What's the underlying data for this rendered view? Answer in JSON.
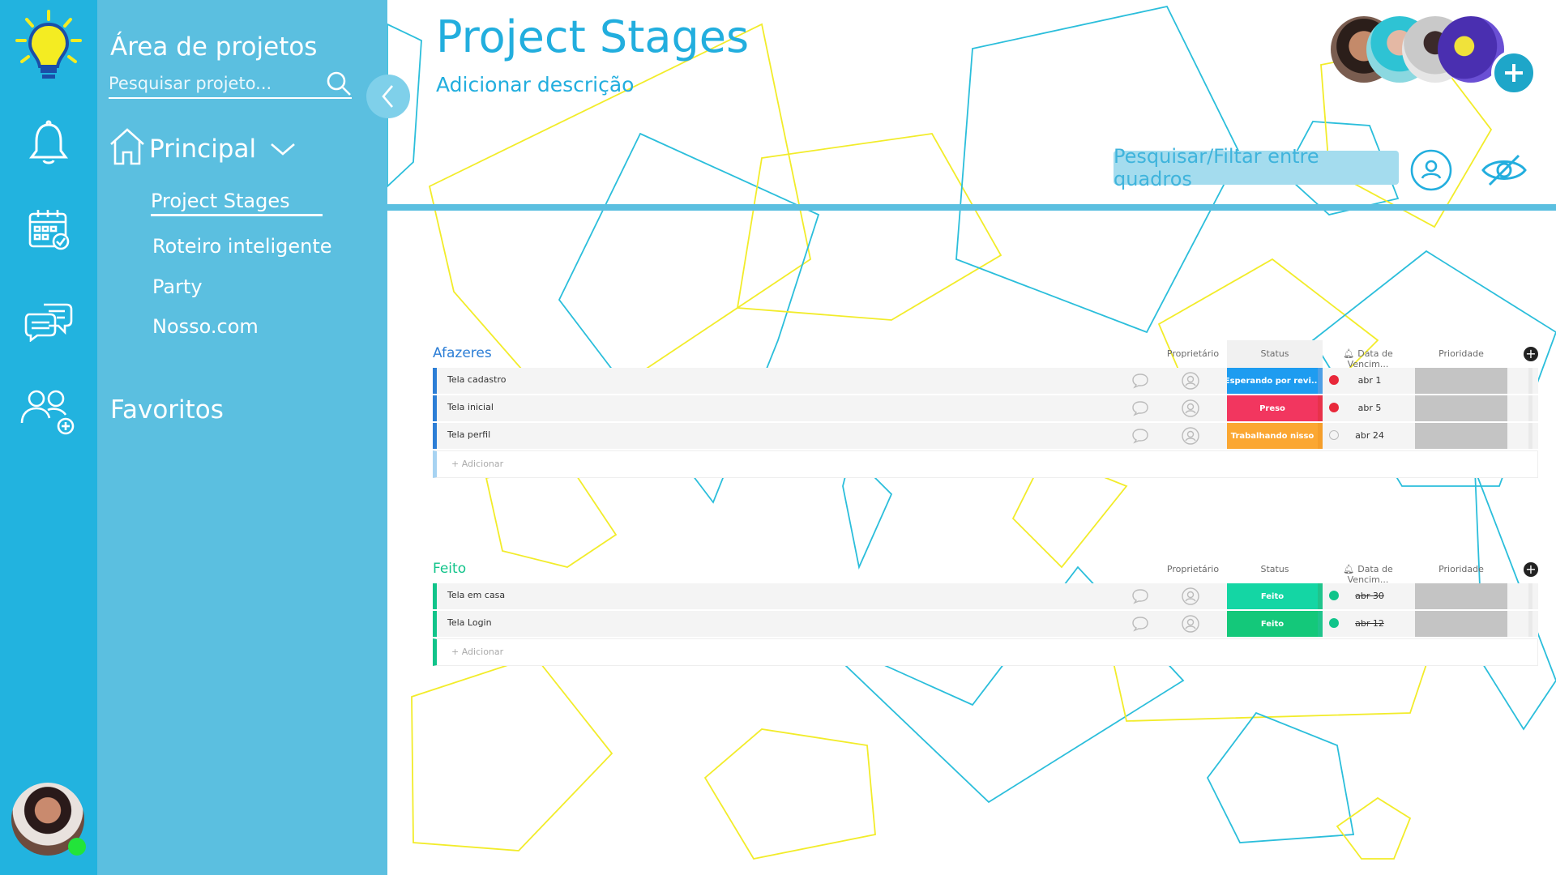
{
  "sidebar": {
    "title": "Área de projetos",
    "search_placeholder": "Pesquisar projeto...",
    "section": "Principal",
    "items": [
      {
        "label": "Project Stages",
        "active": true
      },
      {
        "label": "Roteiro inteligente",
        "active": false
      },
      {
        "label": "Party",
        "active": false
      },
      {
        "label": "Nosso.com",
        "active": false
      }
    ],
    "favorites": "Favoritos"
  },
  "rail": {
    "icons": [
      "lightbulb-logo-icon",
      "bell-icon",
      "calendar-icon",
      "chat-icon",
      "add-user-icon"
    ]
  },
  "header": {
    "title": "Project Stages",
    "description": "Adicionar descrição",
    "filter_text": "Pesquisar/Filtar entre quadros"
  },
  "columns": {
    "owner": "Proprietário",
    "status": "Status",
    "due": "Data de Vencim...",
    "priority": "Prioridade"
  },
  "groups": [
    {
      "title": "Afazeres",
      "color": "#2c7ed6",
      "rows": [
        {
          "name": "Tela cadastro",
          "status": "Esperando por revi...",
          "status_color": "#1e9cf0",
          "alert": "red",
          "date": "abr 1"
        },
        {
          "name": "Tela inicial",
          "status": "Preso",
          "status_color": "#f2365f",
          "alert": "red",
          "date": "abr 5"
        },
        {
          "name": "Tela perfil",
          "status": "Trabalhando nisso",
          "status_color": "#fba732",
          "alert": "empty",
          "date": "abr 24"
        }
      ],
      "add_label": "+ Adicionar"
    },
    {
      "title": "Feito",
      "color": "#11c48a",
      "rows": [
        {
          "name": "Tela em casa",
          "status": "Feito",
          "status_color": "#14d6a4",
          "alert": "green",
          "date": "abr 30"
        },
        {
          "name": "Tela Login",
          "status": "Feito",
          "status_color": "#14c87a",
          "alert": "green",
          "date": "abr 12"
        }
      ],
      "add_label": "+ Adicionar"
    }
  ],
  "colors": {
    "rail": "#22b3df",
    "panel": "#5bbfe0",
    "accent": "#22aede",
    "deco_blue": "#2bbedb",
    "deco_yellow": "#f2ec2a"
  }
}
